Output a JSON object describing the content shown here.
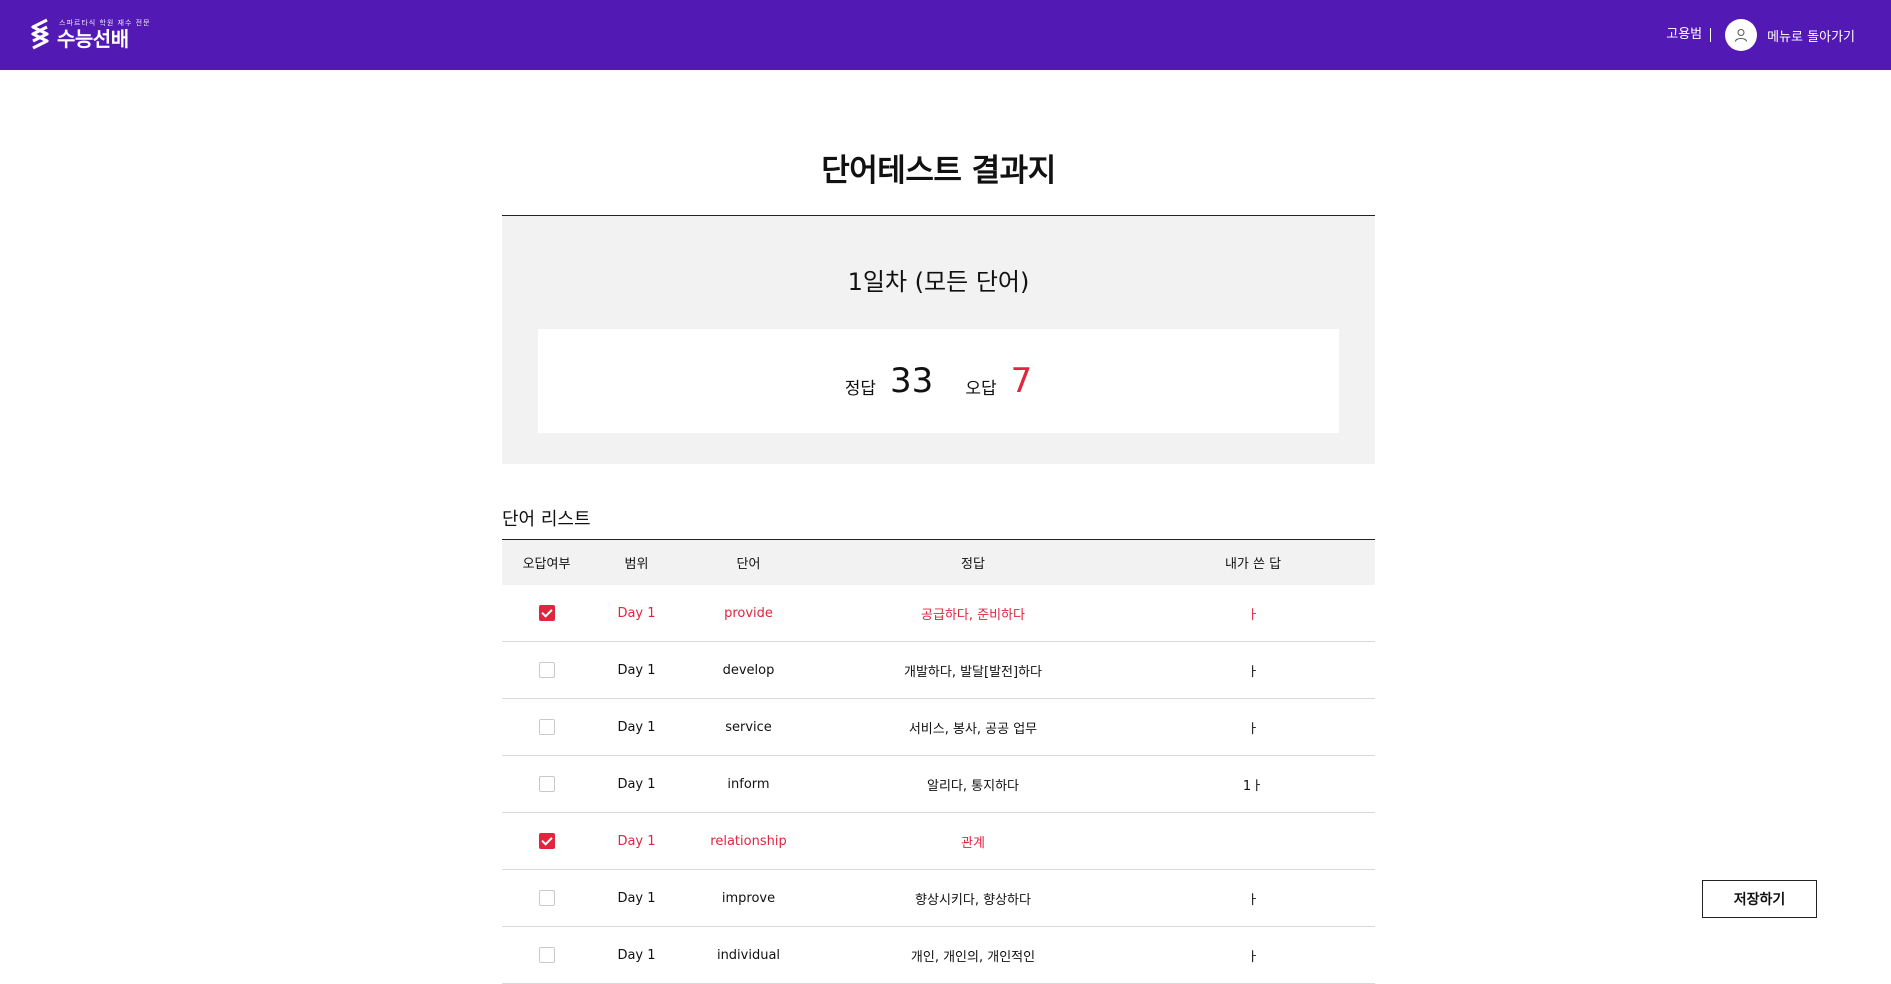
{
  "header": {
    "logo_tagline": "스파르타식 학원 재수 전문",
    "logo_name": "수능선배",
    "user_name": "고용범",
    "back_link": "메뉴로 돌아가기",
    "brand_color": "#5319b5",
    "icons": [
      "logo-mark",
      "user-icon"
    ]
  },
  "page": {
    "title": "단어테스트 결과지"
  },
  "summary": {
    "title": "1일차 (모든 단어)",
    "correct_label": "정답",
    "correct_count": "33",
    "wrong_label": "오답",
    "wrong_count": "7",
    "wrong_color": "#e0253f"
  },
  "list": {
    "title": "단어 리스트",
    "columns": [
      "오답여부",
      "범위",
      "단어",
      "정답",
      "내가 쓴 답"
    ],
    "rows": [
      {
        "wrong": true,
        "range": "Day 1",
        "word": "provide",
        "answer": "공급하다, 준비하다",
        "my_answer": "ㅏ"
      },
      {
        "wrong": false,
        "range": "Day 1",
        "word": "develop",
        "answer": "개발하다, 발달[발전]하다",
        "my_answer": "ㅏ"
      },
      {
        "wrong": false,
        "range": "Day 1",
        "word": "service",
        "answer": "서비스, 봉사, 공공 업무",
        "my_answer": "ㅏ"
      },
      {
        "wrong": false,
        "range": "Day 1",
        "word": "inform",
        "answer": "알리다, 통지하다",
        "my_answer": "1ㅏ"
      },
      {
        "wrong": true,
        "range": "Day 1",
        "word": "relationship",
        "answer": "관계",
        "my_answer": ""
      },
      {
        "wrong": false,
        "range": "Day 1",
        "word": "improve",
        "answer": "향상시키다, 향상하다",
        "my_answer": "ㅏ"
      },
      {
        "wrong": false,
        "range": "Day 1",
        "word": "individual",
        "answer": "개인, 개인의, 개인적인",
        "my_answer": "ㅏ"
      }
    ]
  },
  "actions": {
    "save_label": "저장하기"
  }
}
